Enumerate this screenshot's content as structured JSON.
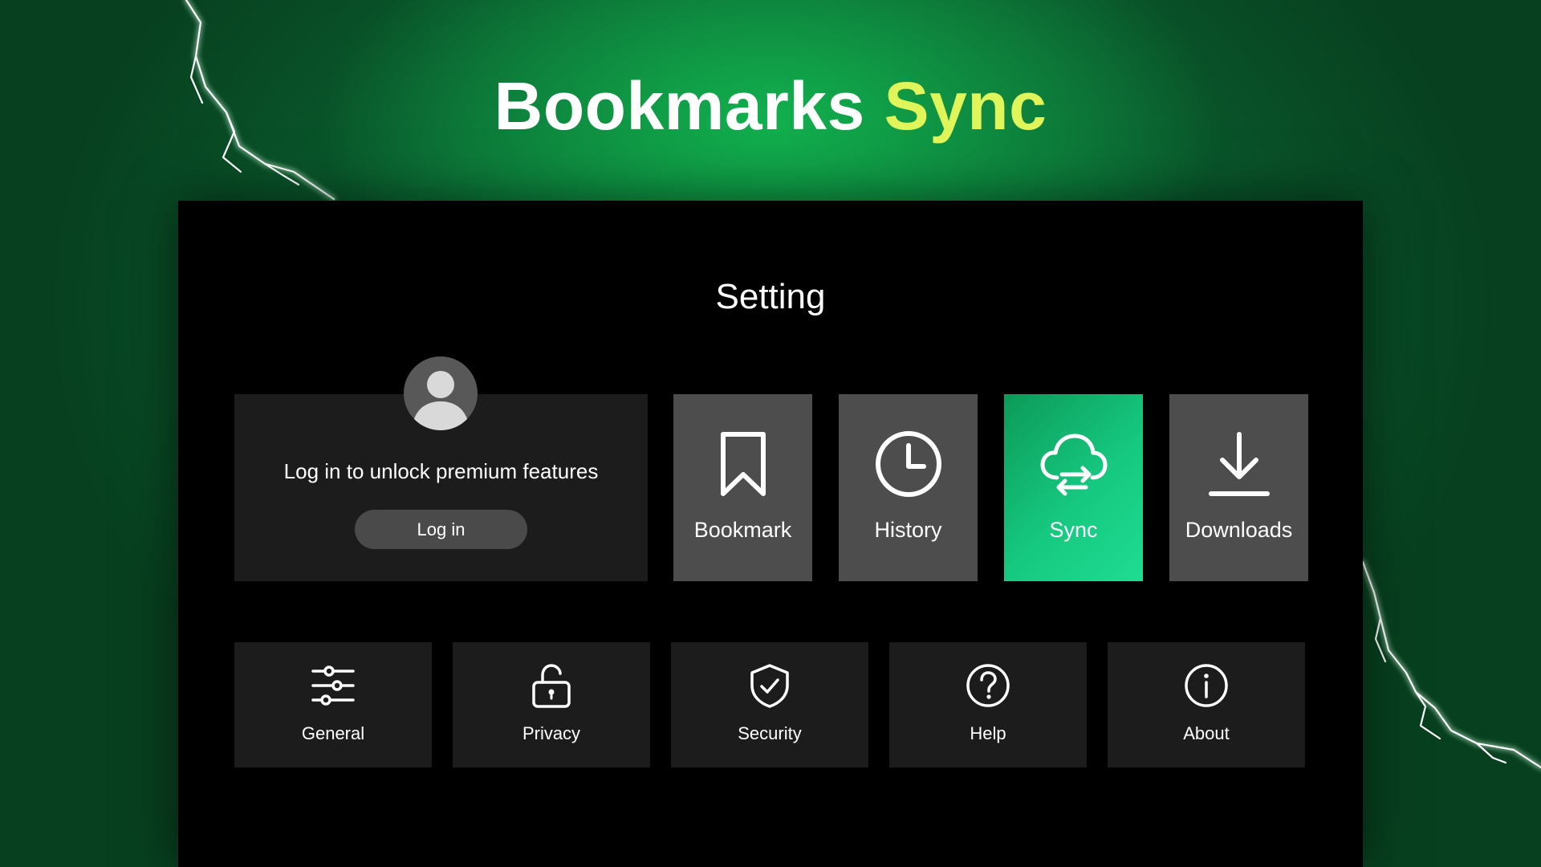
{
  "hero": {
    "title_main": "Bookmarks",
    "title_accent": "Sync"
  },
  "panel": {
    "title": "Setting"
  },
  "login": {
    "prompt": "Log in to unlock premium features",
    "button_label": "Log in",
    "avatar_icon": "user-avatar-icon"
  },
  "main_tiles": [
    {
      "label": "Bookmark",
      "icon": "bookmark-icon",
      "active": false
    },
    {
      "label": "History",
      "icon": "clock-icon",
      "active": false
    },
    {
      "label": "Sync",
      "icon": "cloud-sync-icon",
      "active": true
    },
    {
      "label": "Downloads",
      "icon": "download-icon",
      "active": false
    }
  ],
  "secondary_tiles": [
    {
      "label": "General",
      "icon": "sliders-icon"
    },
    {
      "label": "Privacy",
      "icon": "unlock-icon"
    },
    {
      "label": "Security",
      "icon": "shield-check-icon"
    },
    {
      "label": "Help",
      "icon": "question-circle-icon"
    },
    {
      "label": "About",
      "icon": "info-circle-icon"
    }
  ],
  "colors": {
    "accent_title": "#dff55a",
    "sync_active": "#16c880",
    "tile_gray": "#4d4d4d",
    "card_dark": "#1c1c1c"
  }
}
